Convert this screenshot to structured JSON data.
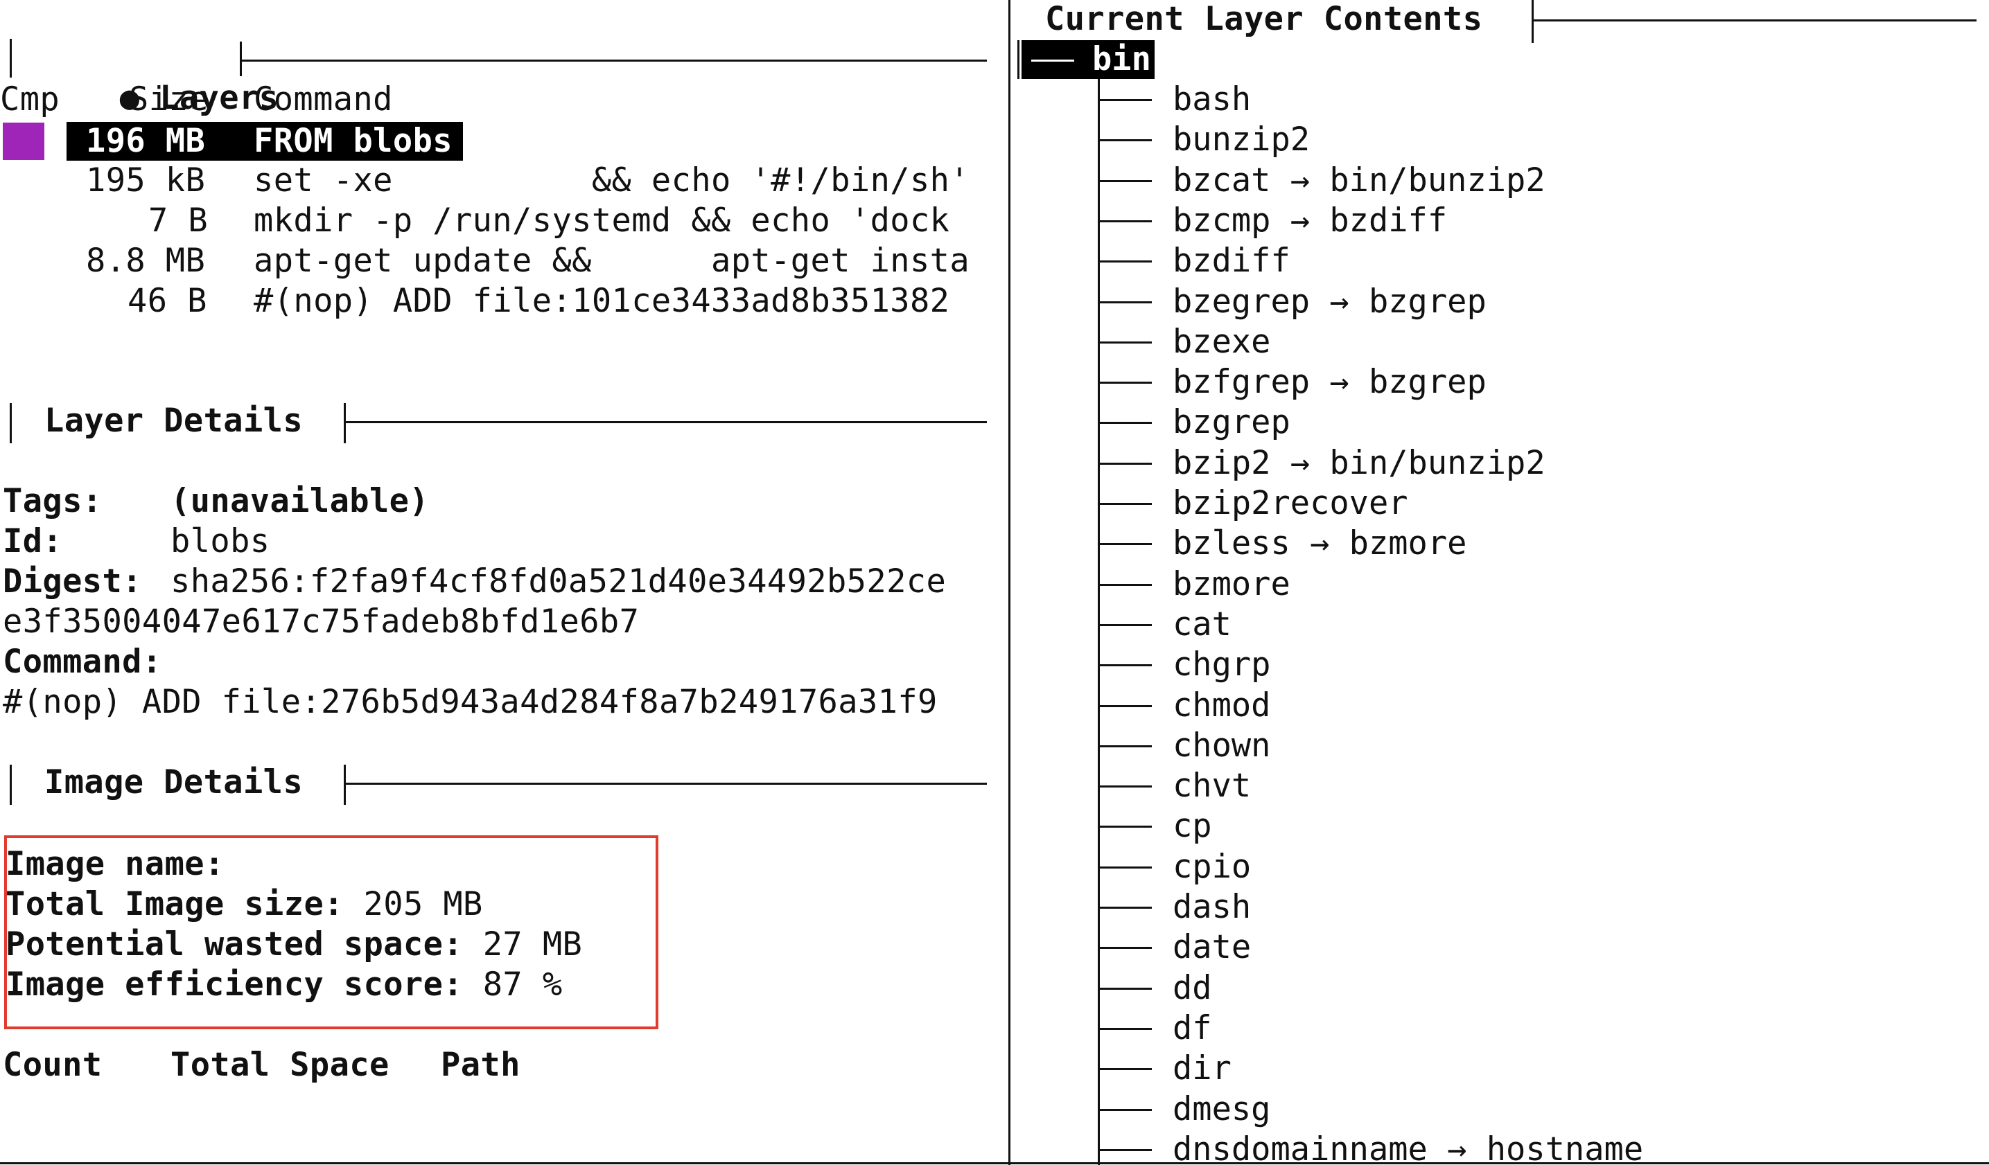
{
  "layers": {
    "title": "Layers",
    "bullet": "●",
    "columns": {
      "cmp": "Cmp",
      "size": "Size",
      "command": "Command"
    },
    "rows": [
      {
        "size": "196 MB",
        "command": "FROM blobs",
        "selected": true
      },
      {
        "size": "195 kB",
        "command": "set -xe          && echo '#!/bin/sh'"
      },
      {
        "size": "7 B",
        "command": "mkdir -p /run/systemd && echo 'dock"
      },
      {
        "size": "8.8 MB",
        "command": "apt-get update &&      apt-get insta"
      },
      {
        "size": "46 B",
        "command": "#(nop) ADD file:101ce3433ad8b351382"
      }
    ],
    "swatch_color": "#9e25b8"
  },
  "layer_details": {
    "title": "Layer Details",
    "tags_label": "Tags:",
    "tags_value": "(unavailable)",
    "id_label": "Id:",
    "id_value": "blobs",
    "digest_label": "Digest:",
    "digest_value_1": "sha256:f2fa9f4cf8fd0a521d40e34492b522ce",
    "digest_value_2": "e3f35004047e617c75fadeb8bfd1e6b7",
    "command_label": "Command:",
    "command_value": "#(nop) ADD file:276b5d943a4d284f8a7b249176a31f9"
  },
  "image_details": {
    "title": "Image Details",
    "name_label": "Image name:",
    "name_value": "",
    "size_label": "Total Image size:",
    "size_value": "205 MB",
    "wasted_label": "Potential wasted space:",
    "wasted_value": "27 MB",
    "efficiency_label": "Image efficiency score:",
    "efficiency_value": "87 %",
    "highlight_color": "#e03c2f"
  },
  "wasted_table": {
    "columns": {
      "count": "Count",
      "total_space": "Total Space",
      "path": "Path"
    }
  },
  "contents": {
    "title": "Current Layer Contents",
    "root": "bin",
    "entries": [
      "bash",
      "bunzip2",
      "bzcat → bin/bunzip2",
      "bzcmp → bzdiff",
      "bzdiff",
      "bzegrep → bzgrep",
      "bzexe",
      "bzfgrep → bzgrep",
      "bzgrep",
      "bzip2 → bin/bunzip2",
      "bzip2recover",
      "bzless → bzmore",
      "bzmore",
      "cat",
      "chgrp",
      "chmod",
      "chown",
      "chvt",
      "cp",
      "cpio",
      "dash",
      "date",
      "dd",
      "df",
      "dir",
      "dmesg",
      "dnsdomainname → hostname"
    ]
  }
}
